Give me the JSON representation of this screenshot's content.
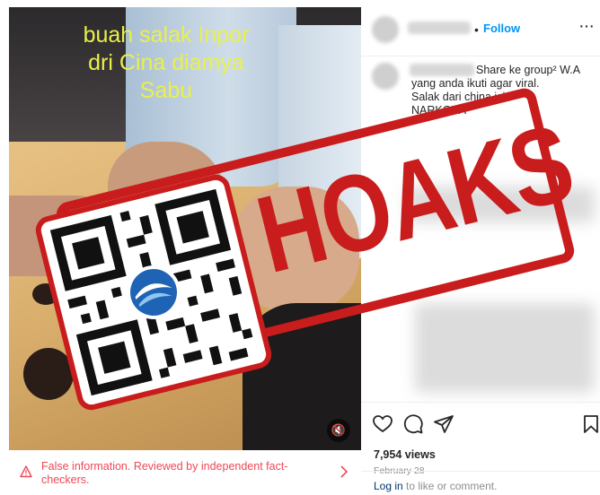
{
  "media": {
    "caption_lines": [
      "buah salak Inpor",
      "dri Cina diamya",
      "Sabu"
    ],
    "mute_icon": "speaker-muted-icon"
  },
  "stamp": {
    "word": "HOAKS",
    "color": "#c91c1c"
  },
  "fact_check": {
    "text": "False information. Reviewed by independent fact-checkers.",
    "color": "#ed4956"
  },
  "header": {
    "follow_label": "Follow",
    "separator": "•",
    "more_label": "···"
  },
  "comment": {
    "lines": [
      "Share ke group² W.A",
      "yang anda ikuti agar viral.",
      "Salak dari china isin",
      "NARKOBA"
    ]
  },
  "stats": {
    "views": "7,954 views",
    "date": "February 28"
  },
  "footer": {
    "login_link": "Log in",
    "login_rest": " to like or comment."
  },
  "colors": {
    "accent": "#0095f6",
    "warning": "#ed4956",
    "stamp": "#c91c1c"
  }
}
